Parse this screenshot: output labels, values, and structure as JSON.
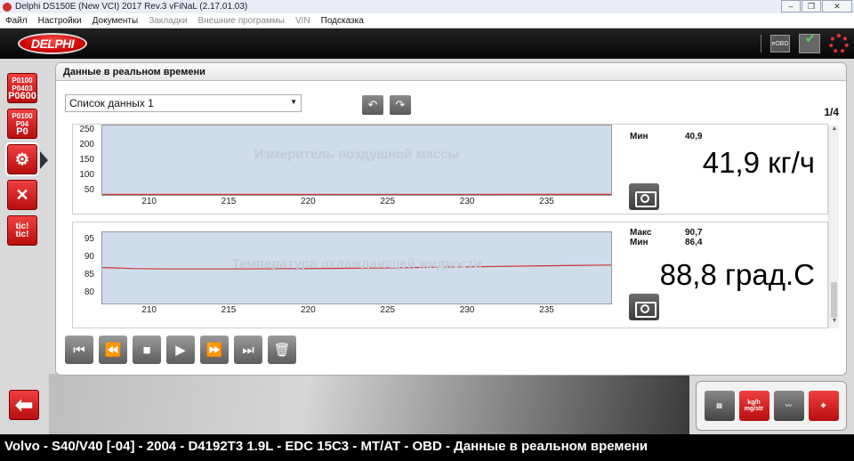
{
  "window": {
    "title": "Delphi DS150E (New VCI) 2017 Rev.3 vFiNaL (2.17.01.03)",
    "minimize": "–",
    "maximize": "❐",
    "close": "✕"
  },
  "menu": [
    {
      "label": "Файл",
      "enabled": true
    },
    {
      "label": "Настройки",
      "enabled": true
    },
    {
      "label": "Документы",
      "enabled": true
    },
    {
      "label": "Закладки",
      "enabled": false
    },
    {
      "label": "Внешние программы",
      "enabled": false
    },
    {
      "label": "VIN",
      "enabled": false
    },
    {
      "label": "Подсказка",
      "enabled": true
    }
  ],
  "header": {
    "logo_text": "DELPHI",
    "eobd_label": "eOBD"
  },
  "left_tools": {
    "dtc_codes": [
      "P0100",
      "P0403",
      "P0600"
    ],
    "dtc2_codes": [
      "P0100",
      "P04",
      "P0"
    ],
    "realtime_icon": "engine-gauge-icon",
    "tools_icon": "wrench-screwdriver-icon",
    "tic_label": "tic! tic!",
    "back_icon": "arrow-left-icon"
  },
  "panel": {
    "tab_title": "Данные в реальном времени",
    "data_list": "Список данных 1",
    "page": "1/4"
  },
  "gauges": [
    {
      "title": "Измеритель воздушной массы",
      "min_label": "Мин",
      "min_value": "40,9",
      "value": "41,9 кг/ч",
      "y_ticks": [
        "250",
        "200",
        "150",
        "100",
        "50"
      ],
      "x_ticks": [
        "210",
        "215",
        "220",
        "225",
        "230",
        "235"
      ],
      "y_range": [
        40,
        270
      ],
      "x_range": [
        207,
        239
      ],
      "series_color": "#cc3333",
      "series": {
        "x": [
          207,
          239
        ],
        "y": [
          41.5,
          41.9
        ]
      }
    },
    {
      "title": "Температура охлаждающей жидкости",
      "max_label": "Макс",
      "max_value": "90,7",
      "min_label": "Мин",
      "min_value": "86,4",
      "value": "88,8 град.С",
      "y_ticks": [
        "95",
        "90",
        "85",
        "80"
      ],
      "x_ticks": [
        "210",
        "215",
        "220",
        "225",
        "230",
        "235"
      ],
      "y_range": [
        77.5,
        97.5
      ],
      "x_range": [
        207,
        239
      ],
      "series_color": "#cc3333",
      "series": {
        "x": [
          207,
          209,
          211,
          215,
          220,
          225,
          230,
          235,
          239
        ],
        "y": [
          87.6,
          87.3,
          87.2,
          87.2,
          87.3,
          87.5,
          87.8,
          88.1,
          88.3
        ]
      }
    }
  ],
  "player": [
    "skip-first-icon",
    "rewind-icon",
    "stop-icon",
    "play-icon",
    "fast-forward-icon",
    "skip-last-icon",
    "delete-icon"
  ],
  "bottom_tools": [
    "computer-printer-icon",
    "data-units-icon",
    "graph-view-icon",
    "add-data-icon"
  ],
  "data_units_text": "kg/h mg/str",
  "status": "Volvo - S40/V40 [-04] - 2004 - D4192T3 1.9L - EDC 15C3 - MT/AT - OBD - Данные в реальном времени"
}
